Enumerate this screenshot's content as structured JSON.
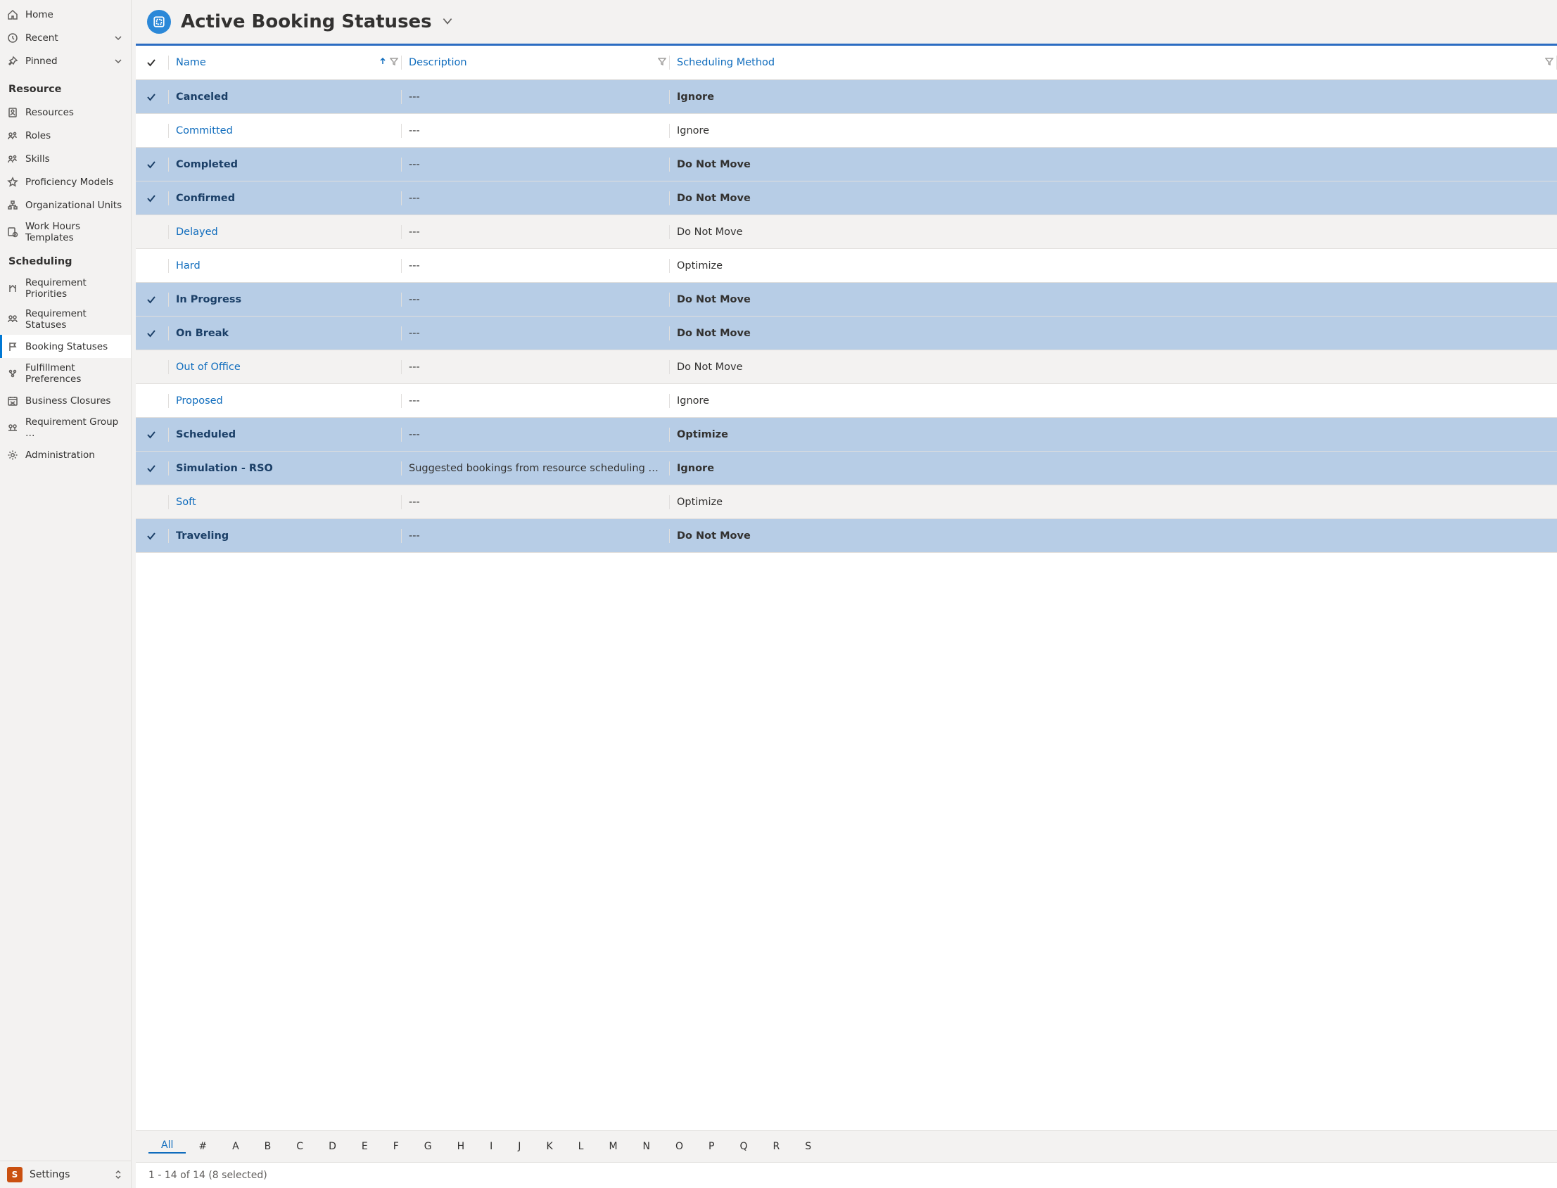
{
  "sidebar": {
    "home": "Home",
    "recent": "Recent",
    "pinned": "Pinned",
    "area": {
      "badge": "S",
      "label": "Settings"
    },
    "groups": [
      {
        "header": "Resource",
        "items": [
          {
            "icon": "resources",
            "label": "Resources"
          },
          {
            "icon": "roles",
            "label": "Roles"
          },
          {
            "icon": "skills",
            "label": "Skills"
          },
          {
            "icon": "star",
            "label": "Proficiency Models"
          },
          {
            "icon": "org",
            "label": "Organizational Units"
          },
          {
            "icon": "hours",
            "label": "Work Hours Templates"
          }
        ]
      },
      {
        "header": "Scheduling",
        "items": [
          {
            "icon": "priority",
            "label": "Requirement Priorities"
          },
          {
            "icon": "reqstatus",
            "label": "Requirement Statuses"
          },
          {
            "icon": "flag",
            "label": "Booking Statuses",
            "active": true
          },
          {
            "icon": "pref",
            "label": "Fulfillment Preferences"
          },
          {
            "icon": "closure",
            "label": "Business Closures"
          },
          {
            "icon": "group",
            "label": "Requirement Group …"
          },
          {
            "icon": "gear",
            "label": "Administration"
          }
        ]
      }
    ]
  },
  "header": {
    "title": "Active Booking Statuses"
  },
  "grid": {
    "columns": {
      "name": "Name",
      "description": "Description",
      "method": "Scheduling Method"
    },
    "rows": [
      {
        "sel": true,
        "name": "Canceled",
        "desc": "---",
        "method": "Ignore"
      },
      {
        "sel": false,
        "name": "Committed",
        "desc": "---",
        "method": "Ignore"
      },
      {
        "sel": true,
        "name": "Completed",
        "desc": "---",
        "method": "Do Not Move"
      },
      {
        "sel": true,
        "name": "Confirmed",
        "desc": "---",
        "method": "Do Not Move"
      },
      {
        "sel": false,
        "alt": true,
        "name": "Delayed",
        "desc": "---",
        "method": "Do Not Move"
      },
      {
        "sel": false,
        "name": "Hard",
        "desc": "---",
        "method": "Optimize"
      },
      {
        "sel": true,
        "name": "In Progress",
        "desc": "---",
        "method": "Do Not Move"
      },
      {
        "sel": true,
        "name": "On Break",
        "desc": "---",
        "method": "Do Not Move"
      },
      {
        "sel": false,
        "alt": true,
        "name": "Out of Office",
        "desc": "---",
        "method": "Do Not Move"
      },
      {
        "sel": false,
        "name": "Proposed",
        "desc": "---",
        "method": "Ignore"
      },
      {
        "sel": true,
        "name": "Scheduled",
        "desc": "---",
        "method": "Optimize"
      },
      {
        "sel": true,
        "name": "Simulation - RSO",
        "desc": "Suggested bookings from resource scheduling optimiz…",
        "method": "Ignore"
      },
      {
        "sel": false,
        "alt": true,
        "name": "Soft",
        "desc": "---",
        "method": "Optimize"
      },
      {
        "sel": true,
        "name": "Traveling",
        "desc": "---",
        "method": "Do Not Move"
      }
    ]
  },
  "alpha": {
    "active": "All",
    "letters": [
      "All",
      "#",
      "A",
      "B",
      "C",
      "D",
      "E",
      "F",
      "G",
      "H",
      "I",
      "J",
      "K",
      "L",
      "M",
      "N",
      "O",
      "P",
      "Q",
      "R",
      "S"
    ]
  },
  "pager": "1 - 14 of 14 (8 selected)"
}
